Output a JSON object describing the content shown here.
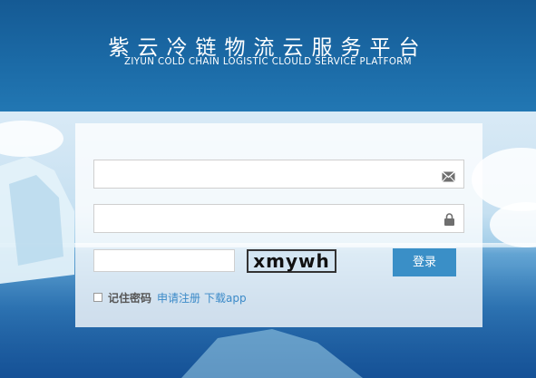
{
  "header": {
    "title": "紫云冷链物流云服务平台",
    "subtitle": "ZIYUN COLD CHAIN LOGISTIC CLOULD SERVICE PLATFORM"
  },
  "form": {
    "email_value": "",
    "password_value": "",
    "captcha_value": "",
    "captcha_text": "xmywh",
    "login_label": "登录",
    "remember_label": "记住密码",
    "register_link": "申请注册",
    "download_link": "下载app"
  },
  "icons": {
    "email": "envelope-icon",
    "password": "lock-icon"
  },
  "colors": {
    "header": "#1b6aa6",
    "button": "#3a8fc7",
    "link": "#3b8ac8"
  }
}
